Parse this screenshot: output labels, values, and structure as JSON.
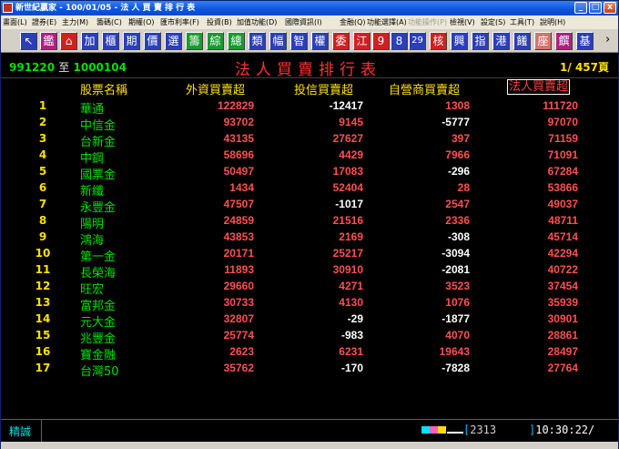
{
  "window": {
    "title": "新世紀贏家 - 100/01/05 - 法 人 買 賣 排 行 表",
    "min_glyph": "_",
    "max_glyph": "□",
    "close_glyph": "x"
  },
  "menu": [
    {
      "label": "畫面(L)",
      "disabled": false
    },
    {
      "label": "證券(E)",
      "disabled": false
    },
    {
      "label": "主力(M)",
      "disabled": false
    },
    {
      "label": "籌碼(C)",
      "disabled": false
    },
    {
      "label": "期權(O)",
      "disabled": false
    },
    {
      "label": "匯市利率(F)",
      "disabled": false
    },
    {
      "label": "投資(B)",
      "disabled": false
    },
    {
      "label": "加值功能(D)",
      "disabled": false
    },
    {
      "label": "國際資訊(I)",
      "disabled": false
    },
    {
      "label": "金融(Q)",
      "disabled": false
    },
    {
      "label": "功能選擇(A)",
      "disabled": false
    },
    {
      "label": "功能操作(P)",
      "disabled": true
    },
    {
      "label": "檢視(V)",
      "disabled": false
    },
    {
      "label": "設定(S)",
      "disabled": false
    },
    {
      "label": "工具(T)",
      "disabled": false
    },
    {
      "label": "說明(H)",
      "disabled": false
    }
  ],
  "toolbar": [
    {
      "name": "pointer-icon",
      "label": "↖",
      "bg": "#2a3fb8",
      "fg": "#ffffff"
    },
    {
      "name": "stock-button",
      "label": "鑑",
      "bg": "#b02080",
      "fg": "#ffffff"
    },
    {
      "name": "home-icon",
      "label": "⌂",
      "bg": "#d02020",
      "fg": "#ffffff"
    },
    {
      "name": "add-button",
      "label": "加",
      "bg": "#2a3fb8",
      "fg": "#ffffff"
    },
    {
      "name": "cabinet-button",
      "label": "櫃",
      "bg": "#2a3fb8",
      "fg": "#ffffff"
    },
    {
      "name": "futures-button",
      "label": "期",
      "bg": "#2a3fb8",
      "fg": "#ffffff"
    },
    {
      "name": "price-button",
      "label": "價",
      "bg": "#2a3fb8",
      "fg": "#ffffff"
    },
    {
      "name": "select-button",
      "label": "選",
      "bg": "#2a3fb8",
      "fg": "#ffffff"
    },
    {
      "name": "chip-button",
      "label": "籌",
      "bg": "#1a9a30",
      "fg": "#ffffff"
    },
    {
      "name": "overview-button",
      "label": "綜",
      "bg": "#1a9a30",
      "fg": "#ffffff"
    },
    {
      "name": "summary-button",
      "label": "總",
      "bg": "#1a9a30",
      "fg": "#ffffff"
    },
    {
      "name": "category-button",
      "label": "類",
      "bg": "#2a3fb8",
      "fg": "#ffffff"
    },
    {
      "name": "width-button",
      "label": "幅",
      "bg": "#2a3fb8",
      "fg": "#ffffff"
    },
    {
      "name": "smart-button",
      "label": "智",
      "bg": "#2a3fb8",
      "fg": "#ffffff"
    },
    {
      "name": "warrant-button",
      "label": "權",
      "bg": "#2a3fb8",
      "fg": "#ffffff"
    },
    {
      "name": "commission-button",
      "label": "委",
      "bg": "#d02020",
      "fg": "#ffffff"
    },
    {
      "name": "jiang-button",
      "label": "江",
      "bg": "#d02020",
      "fg": "#ffffff"
    },
    {
      "name": "nine-button",
      "label": "9",
      "bg": "#d02020",
      "fg": "#ffffff"
    },
    {
      "name": "eight-button",
      "label": "8",
      "bg": "#2a3fb8",
      "fg": "#ffffff"
    },
    {
      "name": "twentynine-button",
      "label": "29",
      "bg": "#2a3fb8",
      "fg": "#ffffff"
    },
    {
      "name": "nucleus-button",
      "label": "核",
      "bg": "#d02020",
      "fg": "#ffffff"
    },
    {
      "name": "interest-button",
      "label": "興",
      "bg": "#2a3fb8",
      "fg": "#ffffff"
    },
    {
      "name": "index-button",
      "label": "指",
      "bg": "#2a3fb8",
      "fg": "#ffffff"
    },
    {
      "name": "hongkong-button",
      "label": "港",
      "bg": "#2a3fb8",
      "fg": "#ffffff"
    },
    {
      "name": "rank-button",
      "label": "饈",
      "bg": "#2a3fb8",
      "fg": "#ffffff"
    },
    {
      "name": "seat-button",
      "label": "座",
      "bg": "#d87070",
      "fg": "#ffffff"
    },
    {
      "name": "settle-button",
      "label": "饌",
      "bg": "#b02080",
      "fg": "#ffffff"
    },
    {
      "name": "fund-button",
      "label": "基",
      "bg": "#2a3fb8",
      "fg": "#ffffff"
    }
  ],
  "toolbar_more": "›",
  "header": {
    "range_from": "991220",
    "range_sep": "至",
    "range_to": "1000104",
    "title": "法人買賣排行表",
    "page": "1/ 457頁"
  },
  "columns": {
    "name": "股票名稱",
    "foreign": "外資買賣超",
    "trust": "投信買賣超",
    "dealer": "自營商買賣超",
    "total": "法人買賣超"
  },
  "rows": [
    {
      "rank": "1",
      "name": "華通",
      "foreign": "122829",
      "trust": "-12417",
      "dealer": "1308",
      "total": "111720"
    },
    {
      "rank": "2",
      "name": "中信金",
      "foreign": "93702",
      "trust": "9145",
      "dealer": "-5777",
      "total": "97070"
    },
    {
      "rank": "3",
      "name": "台新金",
      "foreign": "43135",
      "trust": "27627",
      "dealer": "397",
      "total": "71159"
    },
    {
      "rank": "4",
      "name": "中鋼",
      "foreign": "58696",
      "trust": "4429",
      "dealer": "7966",
      "total": "71091"
    },
    {
      "rank": "5",
      "name": "國票金",
      "foreign": "50497",
      "trust": "17083",
      "dealer": "-296",
      "total": "67284"
    },
    {
      "rank": "6",
      "name": "新纖",
      "foreign": "1434",
      "trust": "52404",
      "dealer": "28",
      "total": "53866"
    },
    {
      "rank": "7",
      "name": "永豐金",
      "foreign": "47507",
      "trust": "-1017",
      "dealer": "2547",
      "total": "49037"
    },
    {
      "rank": "8",
      "name": "陽明",
      "foreign": "24859",
      "trust": "21516",
      "dealer": "2336",
      "total": "48711"
    },
    {
      "rank": "9",
      "name": "鴻海",
      "foreign": "43853",
      "trust": "2169",
      "dealer": "-308",
      "total": "45714"
    },
    {
      "rank": "10",
      "name": "第一金",
      "foreign": "20171",
      "trust": "25217",
      "dealer": "-3094",
      "total": "42294"
    },
    {
      "rank": "11",
      "name": "長榮海",
      "foreign": "11893",
      "trust": "30910",
      "dealer": "-2081",
      "total": "40722"
    },
    {
      "rank": "12",
      "name": "旺宏",
      "foreign": "29660",
      "trust": "4271",
      "dealer": "3523",
      "total": "37454"
    },
    {
      "rank": "13",
      "name": "富邦金",
      "foreign": "30733",
      "trust": "4130",
      "dealer": "1076",
      "total": "35939"
    },
    {
      "rank": "14",
      "name": "元大金",
      "foreign": "32807",
      "trust": "-29",
      "dealer": "-1877",
      "total": "30901"
    },
    {
      "rank": "15",
      "name": "兆豐金",
      "foreign": "25774",
      "trust": "-983",
      "dealer": "4070",
      "total": "28861"
    },
    {
      "rank": "16",
      "name": "寶金融",
      "foreign": "2623",
      "trust": "6231",
      "dealer": "19643",
      "total": "28497"
    },
    {
      "rank": "17",
      "name": "台灣50",
      "foreign": "35762",
      "trust": "-170",
      "dealer": "-7828",
      "total": "27764"
    }
  ],
  "status": {
    "label": "精誠",
    "color_blocks": [
      "#00e0ff",
      "#ff60c0",
      "#ffe000"
    ],
    "bracket_open": "[",
    "count": "2313",
    "bracket_close": "]",
    "time": "10:30:22",
    "time_suffix": "/"
  },
  "colors": {
    "positive": "#ff5050",
    "negative": "#ffffff",
    "rank": "#ffe000",
    "name": "#00e000",
    "title": "#ff3030"
  }
}
